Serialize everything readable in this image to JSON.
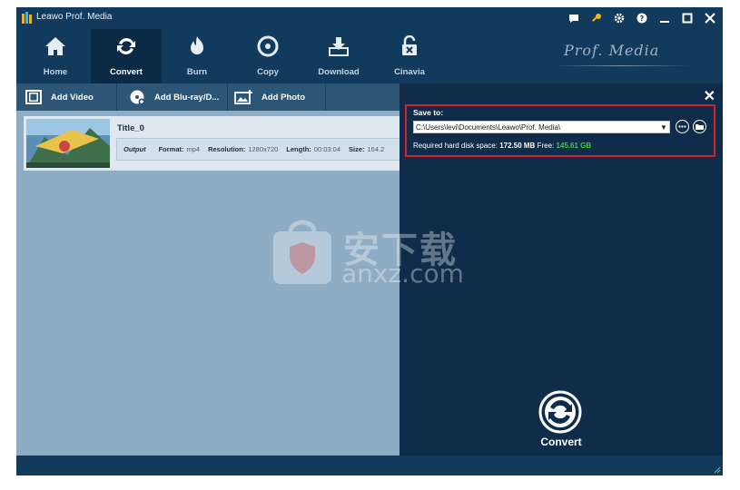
{
  "window": {
    "title": "Leawo Prof. Media"
  },
  "nav": {
    "items": [
      {
        "label": "Home",
        "icon": "home-icon"
      },
      {
        "label": "Convert",
        "icon": "convert-icon",
        "active": true
      },
      {
        "label": "Burn",
        "icon": "burn-icon"
      },
      {
        "label": "Copy",
        "icon": "copy-disc-icon"
      },
      {
        "label": "Download",
        "icon": "download-icon"
      },
      {
        "label": "Cinavia",
        "icon": "cinavia-unlock-icon"
      }
    ],
    "brand": "Prof. Media"
  },
  "toolbar": {
    "add_video": "Add Video",
    "add_bluray": "Add Blu-ray/D...",
    "add_photo": "Add Photo"
  },
  "video": {
    "title": "Title_0",
    "output_label": "Output",
    "format_key": "Format:",
    "format_val": "mp4",
    "resolution_key": "Resolution:",
    "resolution_val": "1280x720",
    "length_key": "Length:",
    "length_val": "00:03:04",
    "size_key": "Size:",
    "size_val": "164.2"
  },
  "panel": {
    "save_to_label": "Save to:",
    "path": "C:\\Users\\levi\\Documents\\Leawo\\Prof. Media\\",
    "disk_label": "Required hard disk space:",
    "disk_required": "172.50 MB",
    "free_label": "Free:",
    "free_value": "145.61 GB",
    "convert_label": "Convert"
  },
  "watermark": {
    "text": "安下载",
    "sub": "anxz.com"
  },
  "colors": {
    "header": "#123a5c",
    "toolbar": "#2d5576",
    "panel": "#0f2d4a",
    "list_bg": "#8eacc4",
    "highlight": "#d8202e",
    "free_green": "#46c846"
  }
}
